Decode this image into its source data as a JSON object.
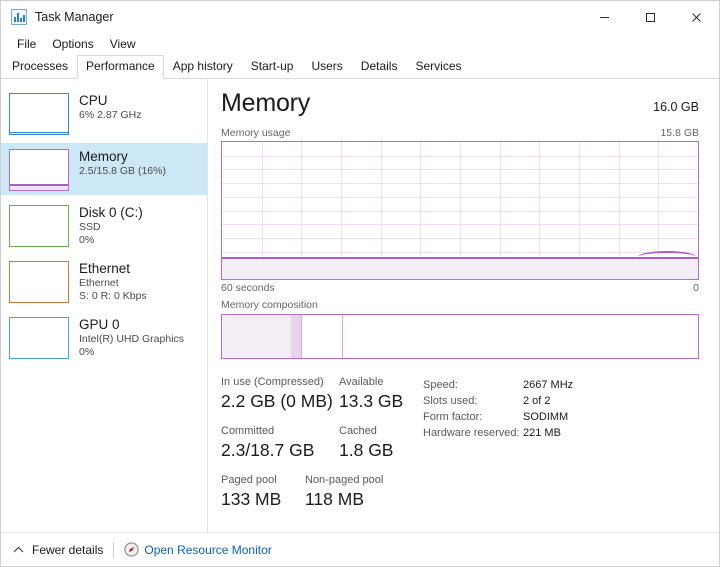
{
  "window": {
    "title": "Task Manager",
    "icon": "task-manager-icon",
    "minimize_label": "—",
    "maximize_label": "□",
    "close_label": "✕"
  },
  "menu": {
    "items": [
      {
        "label": "File"
      },
      {
        "label": "Options"
      },
      {
        "label": "View"
      }
    ]
  },
  "tabs": [
    {
      "label": "Processes",
      "active": false
    },
    {
      "label": "Performance",
      "active": true
    },
    {
      "label": "App history",
      "active": false
    },
    {
      "label": "Start-up",
      "active": false
    },
    {
      "label": "Users",
      "active": false
    },
    {
      "label": "Details",
      "active": false
    },
    {
      "label": "Services",
      "active": false
    }
  ],
  "sidebar": {
    "items": [
      {
        "name": "CPU",
        "title": "CPU",
        "sub1": "6%  2.87 GHz",
        "sub2": "",
        "color": "#3a88c8",
        "selected": false,
        "fill_percent": 6
      },
      {
        "name": "Memory",
        "title": "Memory",
        "sub1": "2.5/15.8 GB (16%)",
        "sub2": "",
        "color": "#b66dc8",
        "selected": true,
        "fill_percent": 16
      },
      {
        "name": "Disk 0 (C:)",
        "title": "Disk 0 (C:)",
        "sub1": "SSD",
        "sub2": "0%",
        "color": "#6ab04c",
        "selected": false,
        "fill_percent": 0
      },
      {
        "name": "Ethernet",
        "title": "Ethernet",
        "sub1": "Ethernet",
        "sub2": "S: 0 R: 0 Kbps",
        "color": "#c47b3e",
        "selected": false,
        "fill_percent": 0
      },
      {
        "name": "GPU 0",
        "title": "GPU 0",
        "sub1": "Intel(R) UHD Graphics",
        "sub2": "0%",
        "color": "#4aa3d8",
        "selected": false,
        "fill_percent": 0
      }
    ]
  },
  "main": {
    "title": "Memory",
    "capacity": "16.0 GB",
    "graph_label": "Memory usage",
    "graph_max_label": "15.8 GB",
    "axis_left": "60 seconds",
    "axis_right": "0",
    "composition_label": "Memory composition"
  },
  "chart_data": {
    "type": "area",
    "title": "Memory usage",
    "xlabel": "",
    "ylabel": "",
    "ylim": [
      0,
      15.8
    ],
    "y_max_label": "15.8 GB",
    "x_left_label": "60 seconds",
    "x_right_label": "0",
    "grid": true,
    "grid_columns": 12,
    "grid_rows": 10,
    "accent_color": "#ab5dc2",
    "fill_color": "#f3eef5",
    "current_value_gb": 2.5,
    "current_percent": 16,
    "series": [
      {
        "name": "In use",
        "values": [
          2.5,
          2.5,
          2.5,
          2.5,
          2.5,
          2.5,
          2.5,
          2.5,
          2.5,
          2.5,
          2.5,
          2.5,
          2.5,
          2.5,
          2.5,
          2.5,
          2.5,
          2.5,
          2.5,
          2.5,
          2.5,
          2.5,
          2.5,
          2.5,
          2.5,
          2.5,
          2.5,
          2.5,
          2.5,
          2.5,
          2.5,
          2.5,
          2.5,
          2.5,
          2.5,
          2.5,
          2.5,
          2.5,
          2.5,
          2.5,
          2.5,
          2.5,
          2.5,
          2.5,
          2.5,
          2.5,
          2.5,
          2.5,
          2.5,
          2.5,
          2.5,
          2.6,
          2.7,
          2.7,
          2.7,
          2.6,
          2.5,
          2.5,
          2.5,
          2.5
        ]
      }
    ],
    "composition": {
      "type": "bar",
      "total_gb": 15.8,
      "segments": [
        {
          "name": "In use",
          "percent": 14.6,
          "color": "#f3eef5",
          "border": ""
        },
        {
          "name": "Modified",
          "percent": 2.1,
          "color": "#e7d5ec",
          "border": ""
        },
        {
          "name": "Standby",
          "percent": 8.5,
          "color": "#ffffff",
          "border": "#d9a8e4"
        },
        {
          "name": "Free",
          "percent": 74.8,
          "color": "#ffffff",
          "border": "#d9a8e4"
        }
      ]
    }
  },
  "stats": {
    "rows": [
      [
        {
          "label": "In use (Compressed)",
          "value": "2.2 GB (0 MB)"
        },
        {
          "label": "Available",
          "value": "13.3 GB"
        }
      ],
      [
        {
          "label": "Committed",
          "value": "2.3/18.7 GB"
        },
        {
          "label": "Cached",
          "value": "1.8 GB"
        }
      ],
      [
        {
          "label": "Paged pool",
          "value": "133 MB"
        },
        {
          "label": "Non-paged pool",
          "value": "118 MB"
        }
      ]
    ],
    "specs": [
      {
        "key": "Speed:",
        "value": "2667 MHz"
      },
      {
        "key": "Slots used:",
        "value": "2 of 2"
      },
      {
        "key": "Form factor:",
        "value": "SODIMM"
      },
      {
        "key": "Hardware reserved:",
        "value": "221 MB"
      }
    ]
  },
  "statusbar": {
    "fewer_details": "Fewer details",
    "resource_monitor": "Open Resource Monitor"
  }
}
